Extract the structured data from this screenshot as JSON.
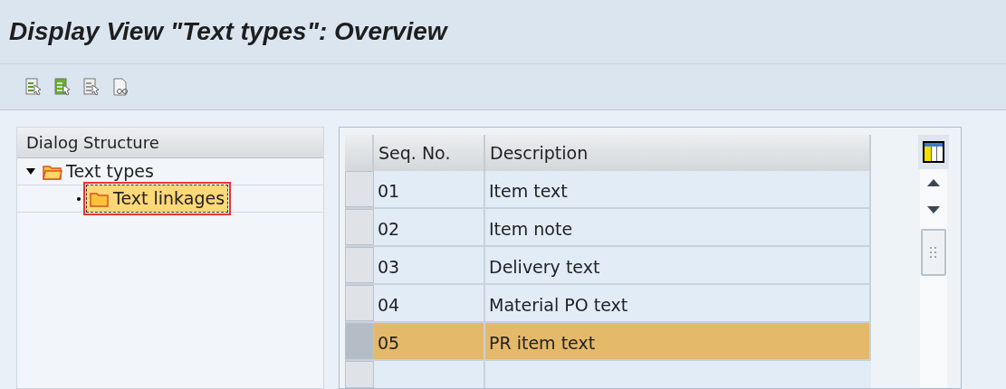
{
  "window": {
    "title": "Display View \"Text types\": Overview"
  },
  "dialog_structure": {
    "title": "Dialog Structure",
    "items": [
      {
        "label": "Text types",
        "expanded": true,
        "selected": false,
        "children": [
          {
            "label": "Text linkages",
            "selected": true
          }
        ]
      }
    ]
  },
  "table": {
    "columns": [
      "Seq. No.",
      "Description"
    ],
    "rows": [
      {
        "cells": [
          "01",
          "Item text"
        ],
        "selected": false
      },
      {
        "cells": [
          "02",
          "Item note"
        ],
        "selected": false
      },
      {
        "cells": [
          "03",
          "Delivery text"
        ],
        "selected": false
      },
      {
        "cells": [
          "04",
          "Material PO text"
        ],
        "selected": false
      },
      {
        "cells": [
          "05",
          "PR item text"
        ],
        "selected": true
      }
    ]
  }
}
